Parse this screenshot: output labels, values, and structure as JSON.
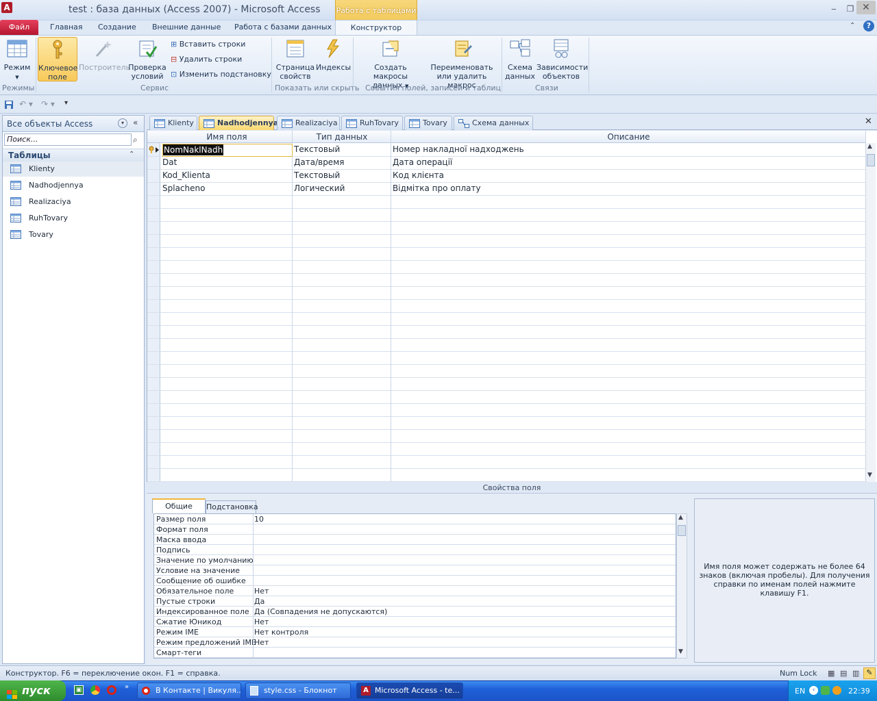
{
  "window": {
    "title": "test : база данных (Access 2007)  -  Microsoft Access",
    "context_tab_group": "Работа с таблицами"
  },
  "ribbon": {
    "tabs": [
      "Файл",
      "Главная",
      "Создание",
      "Внешние данные",
      "Работа с базами данных",
      "Конструктор"
    ],
    "active_tab": "Конструктор",
    "groups": {
      "modes": {
        "label": "Режимы",
        "mode_button": "Режим"
      },
      "service": {
        "label": "Сервис",
        "key_field_line1": "Ключевое",
        "key_field_line2": "поле",
        "builder": "Построитель",
        "validation_line1": "Проверка",
        "validation_line2": "условий",
        "insert_rows": "Вставить строки",
        "delete_rows": "Удалить строки",
        "change_lookup": "Изменить подстановку"
      },
      "show_hide": {
        "label": "Показать или скрыть",
        "property_sheet_line1": "Страница",
        "property_sheet_line2": "свойств",
        "indexes": "Индексы"
      },
      "events": {
        "label": "События полей, записей и таблиц",
        "create_macros_line1": "Создать макросы",
        "create_macros_line2": "данных",
        "rename_macro_line1": "Переименовать",
        "rename_macro_line2": "или удалить макрос"
      },
      "relations": {
        "label": "Связи",
        "schema_line1": "Схема",
        "schema_line2": "данных",
        "deps_line1": "Зависимости",
        "deps_line2": "объектов"
      }
    }
  },
  "nav": {
    "title": "Все объекты Access",
    "search_placeholder": "Поиск...",
    "section": "Таблицы",
    "items": [
      "Klienty",
      "Nadhodjennya",
      "Realizaciya",
      "RuhTovary",
      "Tovary"
    ]
  },
  "doc_tabs": [
    "Klienty",
    "Nadhodjennya",
    "Realizaciya",
    "RuhTovary",
    "Tovary",
    "Схема данных"
  ],
  "active_doc_tab": "Nadhodjennya",
  "design_grid": {
    "headers": [
      "Имя поля",
      "Тип данных",
      "Описание"
    ],
    "rows": [
      {
        "name": "NomNaklNadh",
        "type": "Текстовый",
        "desc": "Номер накладної надходжень"
      },
      {
        "name": "Dat",
        "type": "Дата/время",
        "desc": "Дата операції"
      },
      {
        "name": "Kod_Klienta",
        "type": "Текстовый",
        "desc": "Код клієнта"
      },
      {
        "name": "Splacheno",
        "type": "Логический",
        "desc": "Відмітка про оплату"
      }
    ]
  },
  "field_properties": {
    "section_label": "Свойства поля",
    "tabs": [
      "Общие",
      "Подстановка"
    ],
    "rows": [
      {
        "label": "Размер поля",
        "value": "10"
      },
      {
        "label": "Формат поля",
        "value": ""
      },
      {
        "label": "Маска ввода",
        "value": ""
      },
      {
        "label": "Подпись",
        "value": ""
      },
      {
        "label": "Значение по умолчанию",
        "value": ""
      },
      {
        "label": "Условие на значение",
        "value": ""
      },
      {
        "label": "Сообщение об ошибке",
        "value": ""
      },
      {
        "label": "Обязательное поле",
        "value": "Нет"
      },
      {
        "label": "Пустые строки",
        "value": "Да"
      },
      {
        "label": "Индексированное поле",
        "value": "Да (Совпадения не допускаются)"
      },
      {
        "label": "Сжатие Юникод",
        "value": "Нет"
      },
      {
        "label": "Режим IME",
        "value": "Нет контроля"
      },
      {
        "label": "Режим предложений IME",
        "value": "Нет"
      },
      {
        "label": "Смарт-теги",
        "value": ""
      }
    ],
    "help_text": "Имя поля может содержать не более 64 знаков (включая пробелы). Для получения справки по именам полей нажмите клавишу F1."
  },
  "status": {
    "text": "Конструктор.  F6 = переключение окон.  F1 = справка.",
    "num_lock": "Num Lock"
  },
  "taskbar": {
    "start": "пуск",
    "items": [
      "В Контакте | Викуля...",
      "style.css - Блокнот",
      "Microsoft Access - te..."
    ],
    "lang": "EN",
    "time": "22:39"
  },
  "colors": {
    "file_tab": "#c8203c",
    "context_tab": "#f1c24a",
    "key_button_active": "#f8c95a",
    "ribbon_bg": "#dde8f5"
  }
}
